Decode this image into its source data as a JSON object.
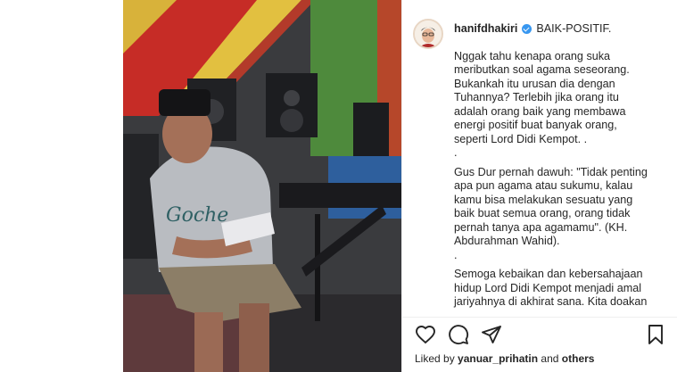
{
  "post": {
    "username": "hanifdhakiri",
    "caption_first_line": "BAIK-POSITIF.",
    "paragraph1": [
      "Nggak tahu kenapa orang suka",
      "meributkan soal agama seseorang.",
      "Bukankah itu urusan dia dengan",
      "Tuhannya? Terlebih jika orang itu",
      "adalah orang baik yang membawa",
      "energi positif buat banyak orang,",
      "seperti Lord Didi Kempot. ."
    ],
    "dot1": ".",
    "paragraph2": [
      "Gus Dur pernah dawuh: \"Tidak penting",
      "apa pun agama atau sukumu, kalau",
      "kamu bisa melakukan sesuatu yang",
      "baik buat semua orang, orang tidak",
      "pernah tanya apa agamamu\". (KH.",
      "Abdurahman Wahid)."
    ],
    "dot2": ".",
    "paragraph3": [
      "Semoga kebaikan dan kebersahajaan",
      "hidup Lord Didi Kempot menjadi amal",
      "jariyahnya di akhirat sana. Kita doakan"
    ],
    "likes_prefix": "Liked by",
    "likes_user": "yanuar_prihatin",
    "likes_and": "and",
    "likes_others": "others"
  },
  "icons": {
    "like": "heart-icon",
    "comment": "comment-icon",
    "share": "paper-plane-icon",
    "save": "bookmark-icon",
    "verified": "verified-badge-icon"
  },
  "colors": {
    "text": "#262626",
    "verified": "#3897f0",
    "border": "#efefef"
  }
}
